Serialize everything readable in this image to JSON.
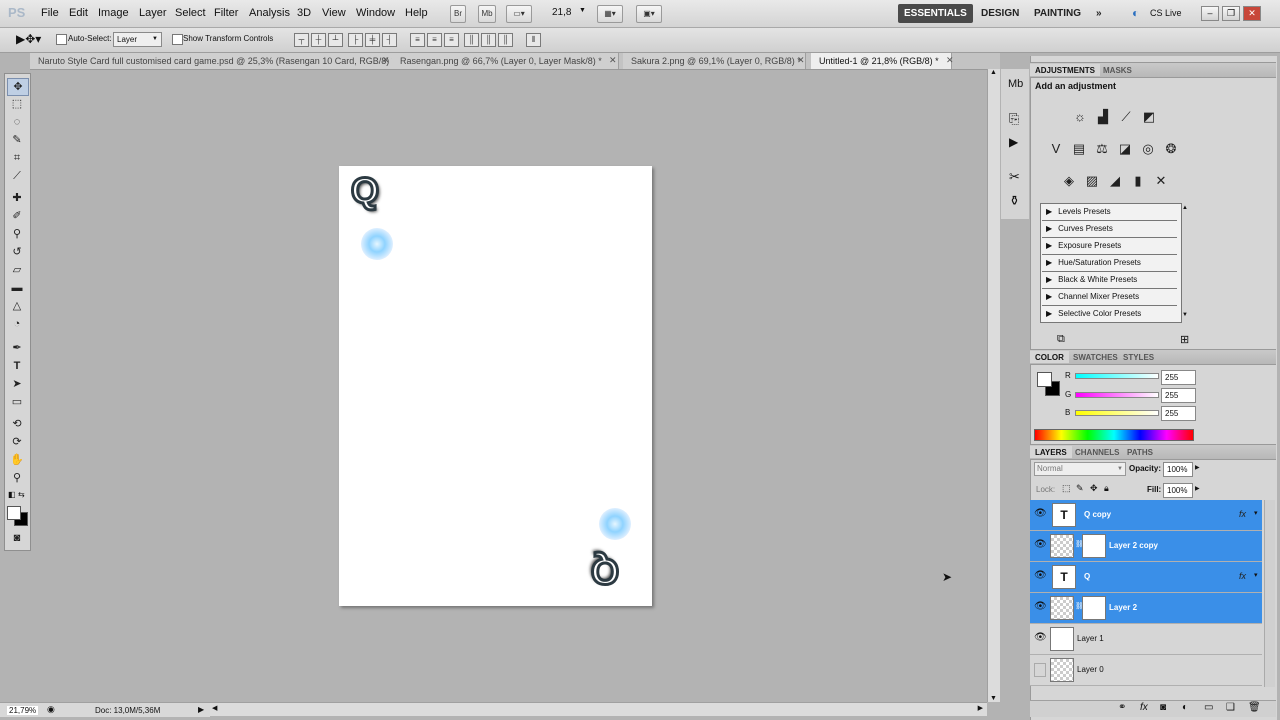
{
  "app": {
    "logo": "PS"
  },
  "menus": [
    "File",
    "Edit",
    "Image",
    "Layer",
    "Select",
    "Filter",
    "Analysis",
    "3D",
    "View",
    "Window",
    "Help"
  ],
  "zoom_dropdown": "21,8",
  "workspaces": {
    "essentials": "ESSENTIALS",
    "design": "DESIGN",
    "painting": "PAINTING",
    "more": "»"
  },
  "cslive": "CS Live",
  "options": {
    "auto_select_label": "Auto-Select:",
    "auto_select_value": "Layer",
    "show_transform": "Show Transform Controls"
  },
  "tabs": [
    {
      "label": "Naruto Style Card full customised card game.psd @ 25,3% (Rasengan 10 Card, RGB/8) *"
    },
    {
      "label": "Rasengan.png @ 66,7% (Layer 0, Layer Mask/8) *"
    },
    {
      "label": "Sakura 2.png @ 69,1% (Layer 0, RGB/8) *"
    },
    {
      "label": "Untitled-1 @ 21,8% (RGB/8) *"
    }
  ],
  "status": {
    "zoom": "21,79%",
    "doc": "Doc: 13,0M/5,36M"
  },
  "adjustments": {
    "tab1": "ADJUSTMENTS",
    "tab2": "MASKS",
    "heading": "Add an adjustment"
  },
  "presets": [
    "Levels Presets",
    "Curves Presets",
    "Exposure Presets",
    "Hue/Saturation Presets",
    "Black & White Presets",
    "Channel Mixer Presets",
    "Selective Color Presets"
  ],
  "color_panel": {
    "tabs": [
      "COLOR",
      "SWATCHES",
      "STYLES"
    ],
    "r_label": "R",
    "g_label": "G",
    "b_label": "B",
    "r": "255",
    "g": "255",
    "b": "255"
  },
  "layers_panel": {
    "tabs": [
      "LAYERS",
      "CHANNELS",
      "PATHS"
    ],
    "blend_mode": "Normal",
    "opacity_label": "Opacity:",
    "opacity": "100%",
    "lock_label": "Lock:",
    "fill_label": "Fill:",
    "fill": "100%",
    "layers": [
      {
        "name": "Q copy",
        "type": "text",
        "selected": true,
        "fx": "fx"
      },
      {
        "name": "Layer 2 copy",
        "type": "masked",
        "selected": true,
        "fx": ""
      },
      {
        "name": "Q",
        "type": "text",
        "selected": true,
        "fx": "fx"
      },
      {
        "name": "Layer 2",
        "type": "masked",
        "selected": true,
        "fx": ""
      },
      {
        "name": "Layer 1",
        "type": "white",
        "selected": false,
        "fx": ""
      },
      {
        "name": "Layer 0",
        "type": "transparent",
        "selected": false,
        "fx": ""
      }
    ]
  },
  "canvas_marks": {
    "corner_letter": "Q"
  }
}
